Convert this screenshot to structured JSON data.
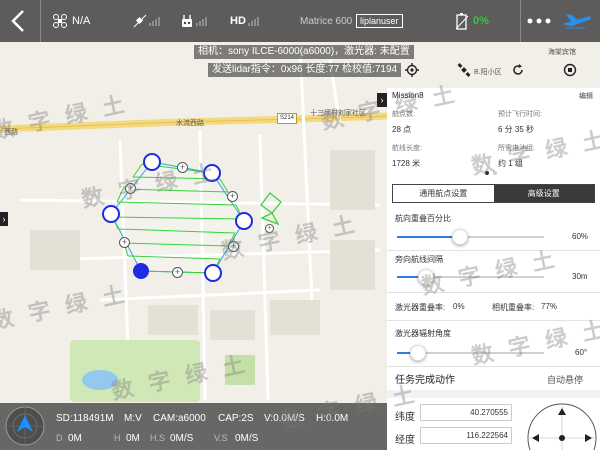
{
  "topbar": {
    "back_icon": "chevron-left-icon",
    "drone_status": "N/A",
    "hd_label": "HD",
    "device": "Matrice 600",
    "user": "liplanuser",
    "battery": "0%",
    "battery_color": "#2ecc40",
    "accent_color": "#2b8ee8"
  },
  "camera_info": {
    "line1": "相机：sony ILCE-6000(a6000)，激光器: 未配置",
    "line2": "发送lidar指令：0x96 长度:77 检校值:7194"
  },
  "map": {
    "road_name": "水流西路",
    "road_shield": "S214",
    "label_west": "西路",
    "label_village": "十三顷村刘家社区",
    "label_hotel": "海棠宾馆",
    "label_community": "B.阳小区"
  },
  "mission": {
    "name": "Mission8",
    "edit_label": "编辑",
    "waypoint_count_label": "航点数:",
    "waypoint_count": "28 点",
    "flight_time_label": "预计飞行时间:",
    "flight_time": "6 分 35 秒",
    "route_length_label": "航线长度:",
    "route_length": "1728 米",
    "battery_needed_label": "所需电池组:",
    "battery_needed": "约 1 组"
  },
  "tabs": {
    "general": "通用航点设置",
    "advanced": "高级设置"
  },
  "settings": {
    "forward_overlap_label": "航向重叠百分比",
    "forward_overlap_value": "60%",
    "forward_overlap_fraction": 0.43,
    "side_spacing_label": "旁向航线间隔",
    "side_spacing_value": "30m",
    "side_spacing_fraction": 0.2,
    "laser_overlap_label": "激光器重叠率:",
    "laser_overlap_value": "0%",
    "camera_overlap_label": "相机重叠率:",
    "camera_overlap_value": "77%",
    "laser_angle_label": "激光器辐射角度",
    "laser_angle_value": "60°",
    "laser_angle_fraction": 0.14,
    "completion_label": "任务完成动作",
    "completion_value": "自动悬停",
    "lat_label": "纬度",
    "lat_value": "40.270555",
    "lon_label": "经度",
    "lon_value": "116.222564"
  },
  "status": {
    "sd": "SD:118491M",
    "mv": "M:V",
    "cam": "CAM:a6000",
    "cap": "CAP:2S",
    "vspeed": "V:0.0M/S",
    "height": "H:0.0M",
    "d": "D",
    "d_val": "0M",
    "h": "H",
    "h_val": "0M",
    "hs": "H.S",
    "hs_val": "0M/S",
    "vs": "V.S",
    "vs_val": "0M/S"
  },
  "watermark": "数 字 绿 土"
}
